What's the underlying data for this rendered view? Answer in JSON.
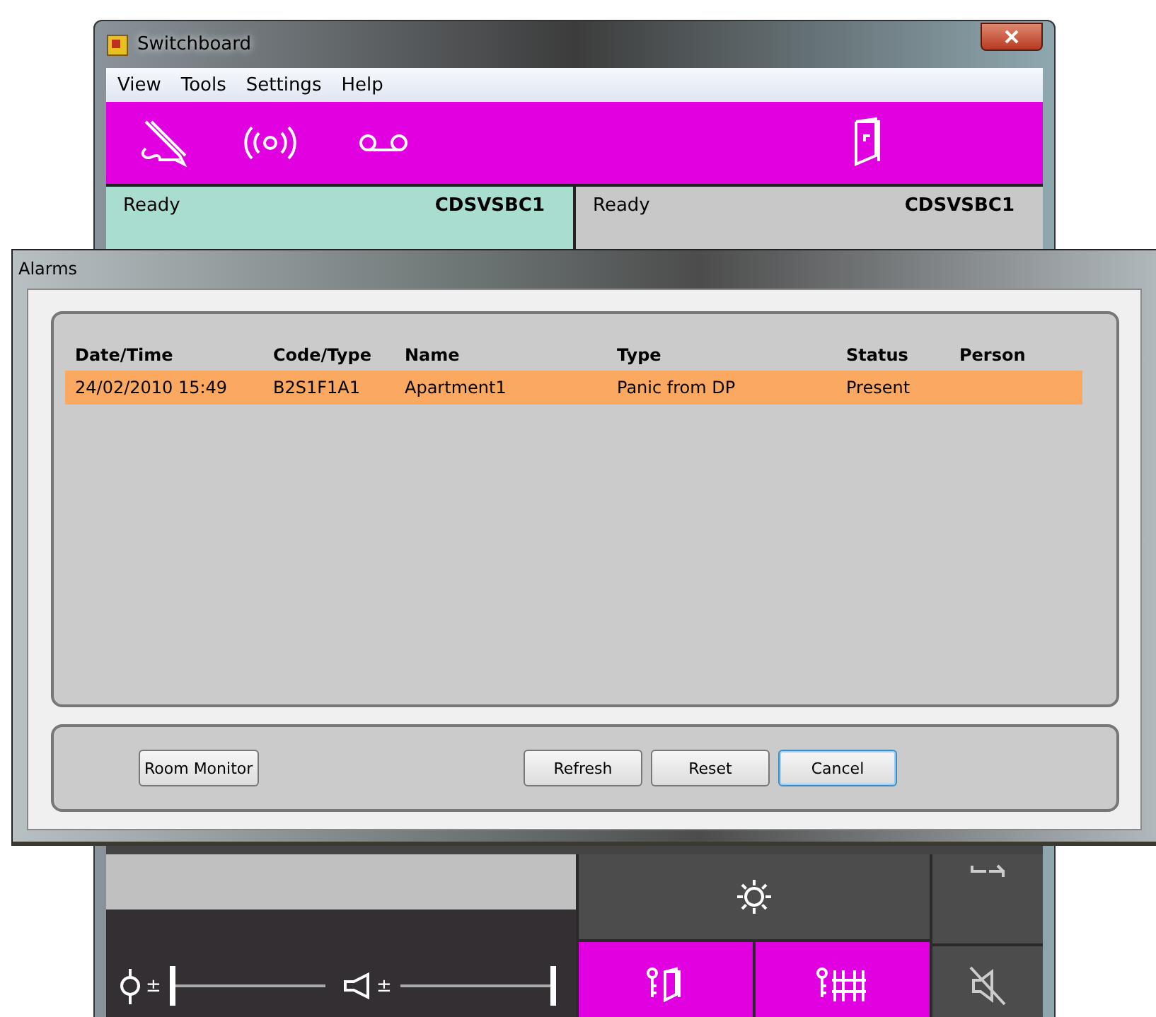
{
  "window": {
    "title": "Switchboard"
  },
  "menu": [
    "View",
    "Tools",
    "Settings",
    "Help"
  ],
  "lines": [
    {
      "status": "Ready",
      "name": "CDSVSBC1",
      "selected": true
    },
    {
      "status": "Ready",
      "name": "CDSVSBC1",
      "selected": false
    }
  ],
  "dialog": {
    "title": "Alarms",
    "columns": [
      "Date/Time",
      "Code/Type",
      "Name",
      "Type",
      "Status",
      "Person"
    ],
    "rows": [
      {
        "cells": [
          "24/02/2010 15:49",
          "B2S1F1A1",
          "Apartment1",
          "Panic from DP",
          "Present",
          ""
        ],
        "selected": true
      }
    ],
    "buttons": [
      {
        "label": "Room Monitor",
        "default": false
      },
      {
        "label": "Refresh",
        "default": false
      },
      {
        "label": "Reset",
        "default": false
      },
      {
        "label": "Cancel",
        "default": true
      }
    ]
  },
  "volume": [
    {
      "kind": "microphone",
      "sign": "±",
      "level": 0
    },
    {
      "kind": "speaker",
      "sign": "±",
      "level": 1
    }
  ]
}
